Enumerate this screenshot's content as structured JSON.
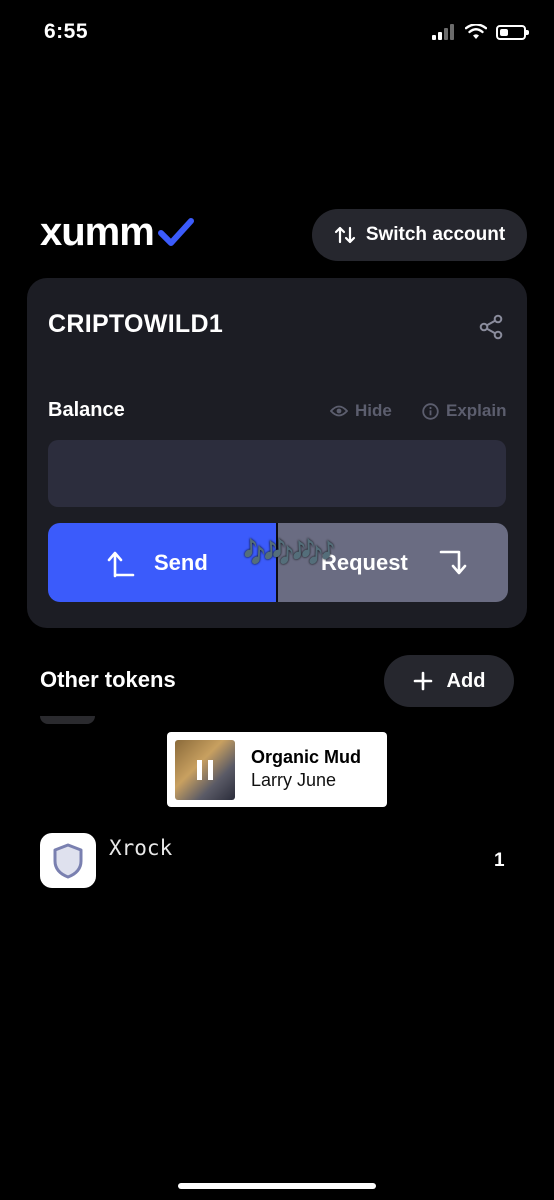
{
  "status_bar": {
    "time": "6:55",
    "icons": [
      "cellular-signal-icon",
      "wifi-icon",
      "battery-icon"
    ],
    "battery_level": 0.35
  },
  "header": {
    "logo_text": "xumm",
    "logo_icon": "checkmark-icon",
    "switch_account_label": "Switch account",
    "switch_account_icon": "swap-arrows-icon"
  },
  "account": {
    "name": "CRIPTOWILD1",
    "share_icon": "share-icon",
    "balance_label": "Balance",
    "hide_label": "Hide",
    "hide_icon": "eye-icon",
    "explain_label": "Explain",
    "explain_icon": "info-icon",
    "send_label": "Send",
    "request_label": "Request",
    "overlay_notes": "🎶🎶🎶"
  },
  "tokens": {
    "section_title": "Other tokens",
    "add_label": "Add",
    "items": [
      {
        "name": "Xrock",
        "amount": "1",
        "icon": "shield-icon"
      }
    ]
  },
  "now_playing": {
    "title": "Organic Mud",
    "artist": "Larry June",
    "icon": "pause-icon"
  },
  "colors": {
    "background": "#000000",
    "card": "#1c1d24",
    "accent": "#3b5bfb",
    "request_button": "#6a6c82",
    "muted_text": "#5c5e6e"
  }
}
